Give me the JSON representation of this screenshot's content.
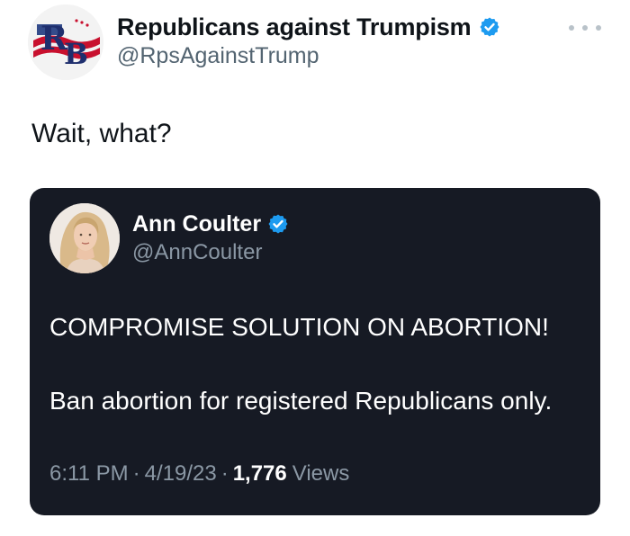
{
  "author": {
    "display_name": "Republicans against Trumpism",
    "handle": "@RpsAgainstTrump",
    "avatar_text": "RB",
    "verified": true
  },
  "tweet": {
    "text": "Wait, what?"
  },
  "quoted_tweet": {
    "author": {
      "display_name": "Ann Coulter",
      "handle": "@AnnCoulter",
      "verified": true
    },
    "lines": [
      "COMPROMISE SOLUTION ON ABORTION!",
      "Ban abortion for registered Republicans only."
    ],
    "time": "6:11 PM",
    "date": "4/19/23",
    "separator": "·",
    "views_count": "1,776",
    "views_label": "Views"
  },
  "colors": {
    "verified_badge": "#1d9bf0",
    "quote_background": "#161a24",
    "secondary_text": "#536471"
  },
  "icons": {
    "more": "more-horizontal-icon",
    "verified": "verified-badge-icon"
  }
}
